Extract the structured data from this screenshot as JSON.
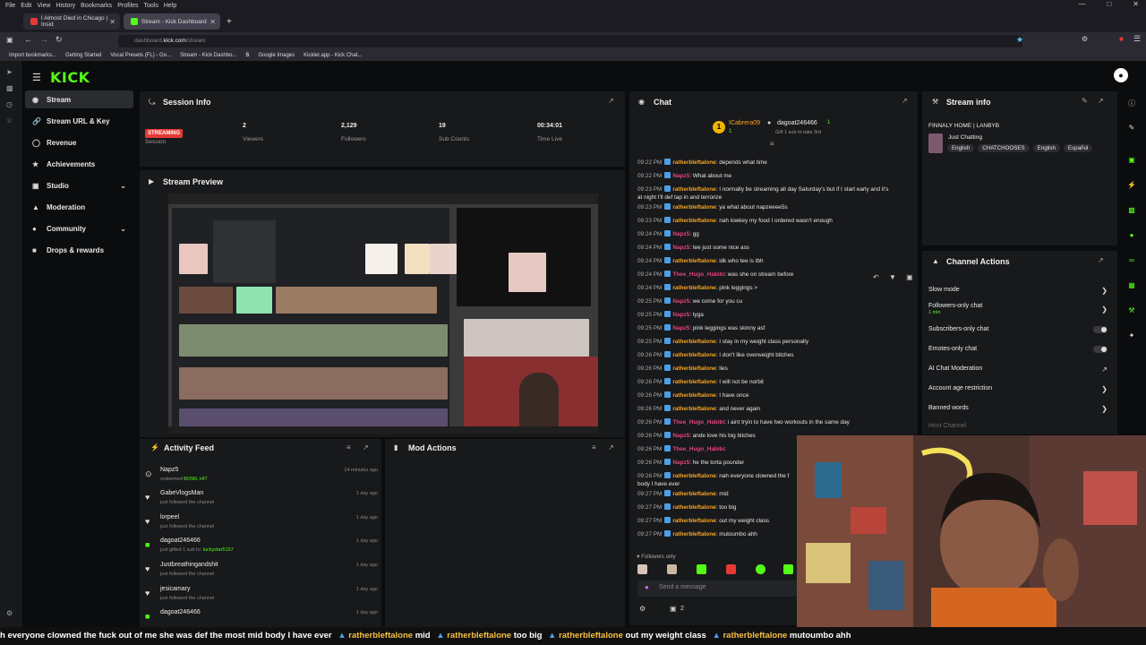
{
  "browser": {
    "menu": [
      "File",
      "Edit",
      "View",
      "History",
      "Bookmarks",
      "Profiles",
      "Tools",
      "Help"
    ],
    "tabs": [
      {
        "label": "I Almost Died in Chicago | Insid"
      },
      {
        "label": "Stream - Kick Dashboard"
      }
    ],
    "url_prefix": "dashboard.",
    "url_domain": "kick.com",
    "url_path": "/stream",
    "bookmarks": [
      "Import bookmarks...",
      "Getting Started",
      "Vocal Presets (FL) - Go...",
      "Stream - Kick Dashbo...",
      "",
      "Google Images",
      "Kicklet.app - Kick Chat..."
    ]
  },
  "app": {
    "logo": "KICK",
    "sidebar": [
      {
        "label": "Stream"
      },
      {
        "label": "Stream URL & Key"
      },
      {
        "label": "Revenue"
      },
      {
        "label": "Achievements"
      },
      {
        "label": "Studio"
      },
      {
        "label": "Moderation"
      },
      {
        "label": "Community"
      },
      {
        "label": "Drops & rewards"
      }
    ],
    "session": {
      "title": "Session Info",
      "status": "STREAMING",
      "status_label": "Session",
      "stats": [
        {
          "value": "2",
          "label": "Viewers"
        },
        {
          "value": "2,129",
          "label": "Followers"
        },
        {
          "value": "19",
          "label": "Sub Counts"
        },
        {
          "value": "00:34:01",
          "label": "Time Live"
        }
      ]
    },
    "preview": {
      "title": "Stream Preview"
    },
    "activity": {
      "title": "Activity Feed",
      "items": [
        {
          "name": "Napz5",
          "sub": "redeemed ",
          "sub2": "BOWL HIT",
          "time": "14 minutes ago"
        },
        {
          "name": "GabeVlogsMan",
          "sub": "just followed the channel",
          "sub2": "",
          "time": "1 day ago"
        },
        {
          "name": "lorpeel",
          "sub": "just followed the channel",
          "sub2": "",
          "time": "1 day ago"
        },
        {
          "name": "dagoat246466",
          "sub": "just gifted 1 sub to: ",
          "sub2": "luckystar5157",
          "time": "1 day ago"
        },
        {
          "name": "Justbreathingandshit",
          "sub": "just followed the channel",
          "sub2": "",
          "time": "1 day ago"
        },
        {
          "name": "jesicamary",
          "sub": "just followed the channel",
          "sub2": "",
          "time": "1 day ago"
        },
        {
          "name": "dagoat246466",
          "sub": "",
          "sub2": "",
          "time": "1 day ago"
        }
      ]
    },
    "mod": {
      "title": "Mod Actions"
    },
    "chat": {
      "title": "Chat",
      "pinned_user1": "ICabrera09",
      "pinned_user2": "dagoat246466",
      "pinned_count1": "1",
      "pinned_count2": "1",
      "pinned_sub": "Gift 1 sub to take 3rd",
      "lines": [
        {
          "t": "09:22 PM",
          "u": "ratherbleftalone",
          "c": "#f5a623",
          "m": ": depends what time"
        },
        {
          "t": "09:22 PM",
          "u": "Napz5",
          "c": "#e0457b",
          "m": ": What about me"
        },
        {
          "t": "09:23 PM",
          "u": "ratherbleftalone",
          "c": "#f5a623",
          "m": ": I normally be streaming all day Saturday's but if I start early and it's"
        },
        {
          "t": "",
          "u": "",
          "c": "#f5a623",
          "m": "at night I'll def tap in and terrorize"
        },
        {
          "t": "09:23 PM",
          "u": "ratherbleftalone",
          "c": "#f5a623",
          "m": ": ya what about napzeeee5s"
        },
        {
          "t": "09:23 PM",
          "u": "ratherbleftalone",
          "c": "#f5a623",
          "m": ": nah lowkey my food I ordered wasn't enough"
        },
        {
          "t": "09:24 PM",
          "u": "Napz5",
          "c": "#e0457b",
          "m": ": gg"
        },
        {
          "t": "09:24 PM",
          "u": "Napz5",
          "c": "#e0457b",
          "m": ": tee just some nice ass"
        },
        {
          "t": "09:24 PM",
          "u": "ratherbleftalone",
          "c": "#f5a623",
          "m": ": idk who tee is tbh"
        },
        {
          "t": "09:24 PM",
          "u": "Thee_Hugo_Habibi",
          "c": "#e0457b",
          "m": ": was she on stream before"
        },
        {
          "t": "09:24 PM",
          "u": "ratherbleftalone",
          "c": "#f5a623",
          "m": ": pink leggings >"
        },
        {
          "t": "09:25 PM",
          "u": "Napz5",
          "c": "#e0457b",
          "m": ": we come for you cu"
        },
        {
          "t": "09:25 PM",
          "u": "Napz5",
          "c": "#e0457b",
          "m": ": tyga"
        },
        {
          "t": "09:25 PM",
          "u": "Napz5",
          "c": "#e0457b",
          "m": ": pink leggings was skinny asf"
        },
        {
          "t": "09:25 PM",
          "u": "ratherbleftalone",
          "c": "#f5a623",
          "m": ": I stay in my weight class personally"
        },
        {
          "t": "09:26 PM",
          "u": "ratherbleftalone",
          "c": "#f5a623",
          "m": ": I don't like overweight bitches"
        },
        {
          "t": "09:26 PM",
          "u": "ratherbleftalone",
          "c": "#f5a623",
          "m": ": lies"
        },
        {
          "t": "09:26 PM",
          "u": "ratherbleftalone",
          "c": "#f5a623",
          "m": ": I will not be norbit"
        },
        {
          "t": "09:26 PM",
          "u": "ratherbleftalone",
          "c": "#f5a623",
          "m": ": I have once"
        },
        {
          "t": "09:26 PM",
          "u": "ratherbleftalone",
          "c": "#f5a623",
          "m": ": and never again"
        },
        {
          "t": "09:26 PM",
          "u": "Thee_Hugo_Habibi",
          "c": "#e0457b",
          "m": ": i aint tryin to have two workouts in the same day"
        },
        {
          "t": "09:26 PM",
          "u": "Napz5",
          "c": "#e0457b",
          "m": ": ande love his big bitches"
        },
        {
          "t": "09:26 PM",
          "u": "Thee_Hugo_Habibi",
          "c": "#e0457b",
          "m": ":"
        },
        {
          "t": "09:26 PM",
          "u": "Napz5",
          "c": "#e0457b",
          "m": ": he the torta pounder"
        },
        {
          "t": "09:26 PM",
          "u": "ratherbleftalone",
          "c": "#f5a623",
          "m": ": nah everyone clowned the f"
        },
        {
          "t": "",
          "u": "",
          "c": "#f5a623",
          "m": "body I have ever"
        },
        {
          "t": "09:27 PM",
          "u": "ratherbleftalone",
          "c": "#f5a623",
          "m": ": mid"
        },
        {
          "t": "09:27 PM",
          "u": "ratherbleftalone",
          "c": "#f5a623",
          "m": ": too big"
        },
        {
          "t": "09:27 PM",
          "u": "ratherbleftalone",
          "c": "#f5a623",
          "m": ": out my weight class"
        },
        {
          "t": "09:27 PM",
          "u": "ratherbleftalone",
          "c": "#f5a623",
          "m": ": mutoumbo ahh"
        }
      ],
      "followers_only": "Followers only",
      "input_placeholder": "Send a message",
      "count": "2"
    },
    "stream_info": {
      "title": "Stream info",
      "stream_title": "FINNALY HOME | LANBYB",
      "category": "Just Chatting",
      "tags": [
        "English",
        "CHATCHOOSES",
        "English",
        "Español"
      ]
    },
    "channel_actions": {
      "title": "Channel Actions",
      "rows": [
        {
          "label": "Slow mode",
          "sub": ""
        },
        {
          "label": "Followers-only chat",
          "sub": "1 min"
        },
        {
          "label": "Subscribers-only chat",
          "sub": ""
        },
        {
          "label": "Emotes-only chat",
          "sub": ""
        },
        {
          "label": "AI Chat Moderation",
          "sub": ""
        },
        {
          "label": "Account age restriction",
          "sub": ""
        },
        {
          "label": "Banned words",
          "sub": ""
        },
        {
          "label": "Host Channel",
          "sub": ""
        }
      ]
    },
    "ticker": {
      "text1": "h everyone clowned the fuck out of me she was def the most mid body I have ever",
      "u1": "ratherbleftalone",
      "m1": "mid",
      "u2": "ratherbleftalone",
      "m2": "too big",
      "u3": "ratherbleftalone",
      "m3": "out my weight class",
      "u4": "ratherbleftalone",
      "m4": "mutoumbo ahh"
    }
  },
  "colors": {
    "kick_green": "#53fc18",
    "streaming_red": "#e53935",
    "username_orange": "#f5a623",
    "username_pink": "#e0457b"
  }
}
